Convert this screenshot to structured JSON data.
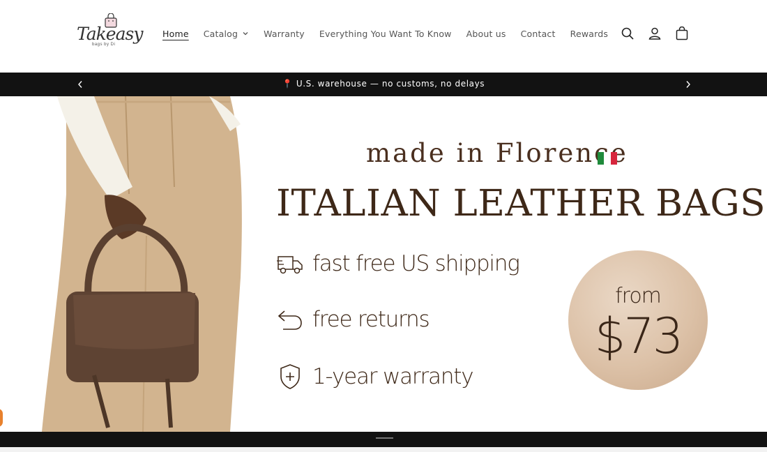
{
  "brand": {
    "logo_text": "Takeasy",
    "logo_subtext": "bags by Di"
  },
  "nav": {
    "items": [
      {
        "label": "Home",
        "active": true
      },
      {
        "label": "Catalog",
        "has_dropdown": true
      },
      {
        "label": "Warranty"
      },
      {
        "label": "Everything You Want To Know"
      },
      {
        "label": "About us"
      },
      {
        "label": "Contact"
      },
      {
        "label": "Rewards"
      }
    ]
  },
  "header_icons": [
    "search-icon",
    "account-icon",
    "cart-icon"
  ],
  "announcement": {
    "text": "📍 U.S. warehouse — no customs, no delays"
  },
  "hero": {
    "subtitle": "made in Florence",
    "title": "ITALIAN LEATHER BAGS",
    "features": [
      {
        "icon": "truck-icon",
        "label": "fast free US shipping"
      },
      {
        "icon": "return-arrow-icon",
        "label": "free returns"
      },
      {
        "icon": "shield-plus-icon",
        "label": "1-year warranty"
      }
    ],
    "price_from": "from",
    "price_value": "$73"
  },
  "colors": {
    "announcement_bg": "#121212",
    "hero_text": "#3e2818",
    "price_circle": "#dcc1a7",
    "flag": [
      "#1f8a3b",
      "#ffffff",
      "#d7263d"
    ]
  }
}
